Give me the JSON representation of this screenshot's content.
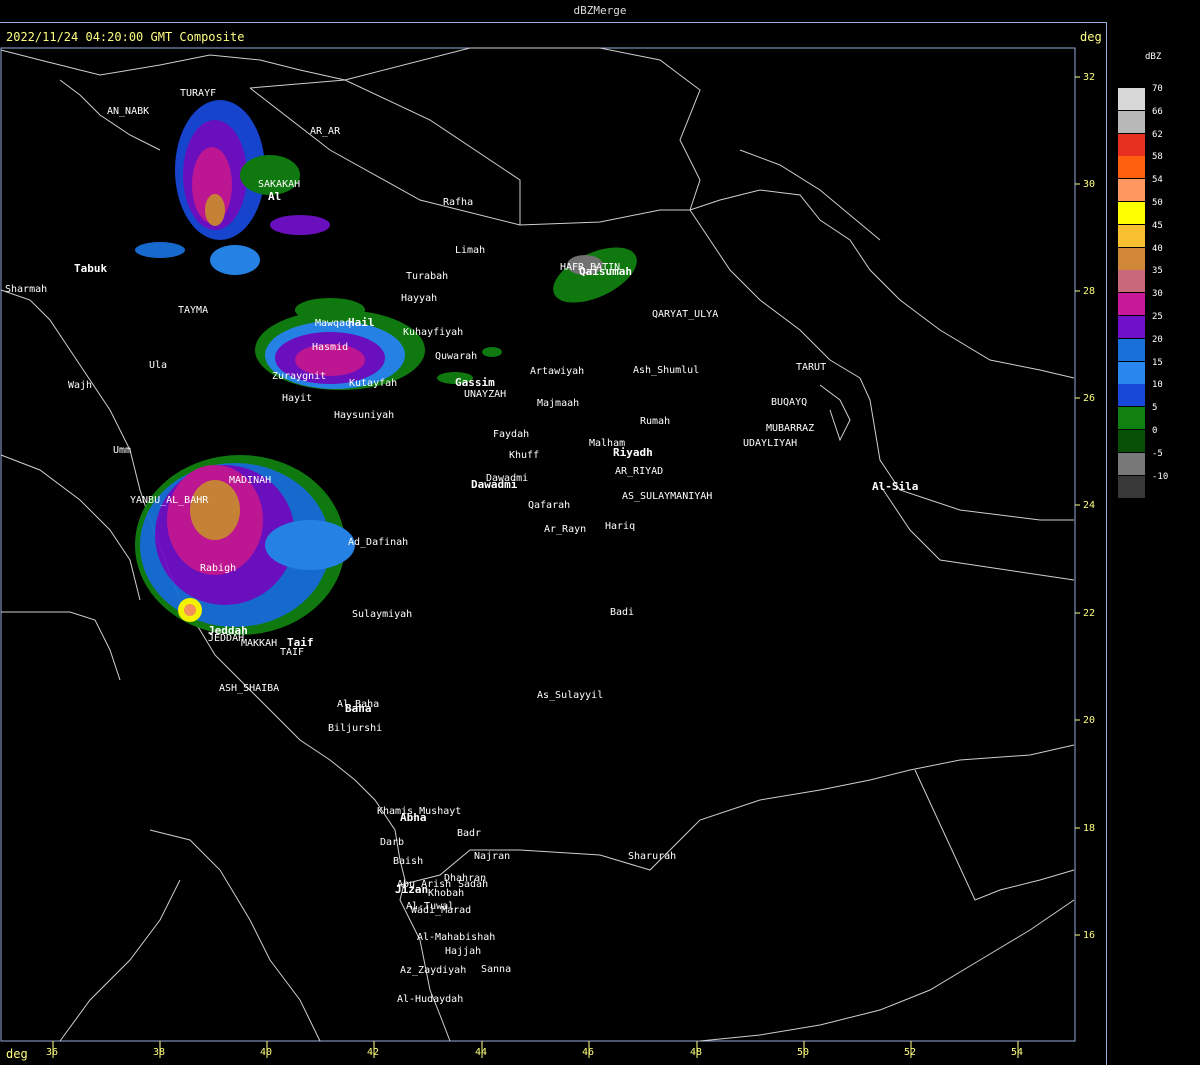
{
  "title": "dBZMerge",
  "header": "2022/11/24 04:20:00 GMT Composite",
  "deg_label_top": "deg",
  "deg_label_bottom": "deg",
  "legend": {
    "unit": "dBZ",
    "levels": [
      {
        "label": "70",
        "color": "#d8d8d8"
      },
      {
        "label": "66",
        "color": "#b8b8b8"
      },
      {
        "label": "62",
        "color": "#e83020"
      },
      {
        "label": "58",
        "color": "#ff6010"
      },
      {
        "label": "54",
        "color": "#ff9860"
      },
      {
        "label": "50",
        "color": "#ffff00"
      },
      {
        "label": "45",
        "color": "#f8c030"
      },
      {
        "label": "40",
        "color": "#d08838"
      },
      {
        "label": "35",
        "color": "#c86878"
      },
      {
        "label": "30",
        "color": "#c8189a"
      },
      {
        "label": "25",
        "color": "#7010c8"
      },
      {
        "label": "20",
        "color": "#1870d8"
      },
      {
        "label": "15",
        "color": "#2888f0"
      },
      {
        "label": "10",
        "color": "#1848d8"
      },
      {
        "label": "5",
        "color": "#108010"
      },
      {
        "label": "0",
        "color": "#085008"
      },
      {
        "label": "-5",
        "color": "#787878"
      },
      {
        "label": "-10",
        "color": "#383838"
      }
    ]
  },
  "lat_ticks": [
    "32",
    "30",
    "28",
    "26",
    "24",
    "22",
    "20",
    "18",
    "16"
  ],
  "lon_ticks": [
    "36",
    "38",
    "40",
    "42",
    "44",
    "46",
    "48",
    "50",
    "52",
    "54"
  ],
  "places": [
    {
      "name": "AN_NABK"
    },
    {
      "name": "TURAYF"
    },
    {
      "name": "AR_AR"
    },
    {
      "name": "SAKAKAH"
    },
    {
      "name": "Al"
    },
    {
      "name": "Rafha"
    },
    {
      "name": "Limah"
    },
    {
      "name": "Tabuk"
    },
    {
      "name": "Sharmah"
    },
    {
      "name": "TAYMA"
    },
    {
      "name": "Turabah"
    },
    {
      "name": "Hayyah"
    },
    {
      "name": "Mawqaq"
    },
    {
      "name": "Hail"
    },
    {
      "name": "Kuhayfiyah"
    },
    {
      "name": "Hasmid"
    },
    {
      "name": "Quwarah"
    },
    {
      "name": "Zuraygnit"
    },
    {
      "name": "Kutayfah"
    },
    {
      "name": "Gassim"
    },
    {
      "name": "UNAYZAH"
    },
    {
      "name": "Hayit"
    },
    {
      "name": "Haysuniyah"
    },
    {
      "name": "Ula"
    },
    {
      "name": "Wajh"
    },
    {
      "name": "Umm"
    },
    {
      "name": "MADINAH"
    },
    {
      "name": "YANBU_AL_BAHR"
    },
    {
      "name": "Ad_Dafinah"
    },
    {
      "name": "Rabigh"
    },
    {
      "name": "Jeddah"
    },
    {
      "name": "JEDDAH"
    },
    {
      "name": "MAKKAH"
    },
    {
      "name": "Taif"
    },
    {
      "name": "TAIF"
    },
    {
      "name": "Sulaymiyah"
    },
    {
      "name": "ASH_SHAIBA"
    },
    {
      "name": "Al_Baha"
    },
    {
      "name": "Baha"
    },
    {
      "name": "Biljurshi"
    },
    {
      "name": "HAFR_BATIN"
    },
    {
      "name": "Qaisumah"
    },
    {
      "name": "QARYAT_ULYA"
    },
    {
      "name": "Artawiyah"
    },
    {
      "name": "Ash_Shumlul"
    },
    {
      "name": "Majmaah"
    },
    {
      "name": "Rumah"
    },
    {
      "name": "Faydah"
    },
    {
      "name": "Khuff"
    },
    {
      "name": "Malham"
    },
    {
      "name": "Riyadh"
    },
    {
      "name": "AR_RIYAD"
    },
    {
      "name": "Dawadmi"
    },
    {
      "name": "Dawadmi"
    },
    {
      "name": "AS_SULAYMANIYAH"
    },
    {
      "name": "Qafarah"
    },
    {
      "name": "Ar_Rayn"
    },
    {
      "name": "Hariq"
    },
    {
      "name": "Badi"
    },
    {
      "name": "As_Sulayyil"
    },
    {
      "name": "TARUT"
    },
    {
      "name": "BUQAYQ"
    },
    {
      "name": "MUBARRAZ"
    },
    {
      "name": "UDAYLIYAH"
    },
    {
      "name": "Al-Sila"
    },
    {
      "name": "Khamis_Mushayt"
    },
    {
      "name": "Abha"
    },
    {
      "name": "Badr"
    },
    {
      "name": "Darb"
    },
    {
      "name": "Baish"
    },
    {
      "name": "Najran"
    },
    {
      "name": "Sharurah"
    },
    {
      "name": "Dhahran"
    },
    {
      "name": "Sadah"
    },
    {
      "name": "Abu_Arish"
    },
    {
      "name": "Jizan"
    },
    {
      "name": "Khobah"
    },
    {
      "name": "Al-Tuwal"
    },
    {
      "name": "Wadi_Marad"
    },
    {
      "name": "Al-Mahabishah"
    },
    {
      "name": "Hajjah"
    },
    {
      "name": "Az_Zaydiyah"
    },
    {
      "name": "Sanna"
    },
    {
      "name": "Al-Hudaydah"
    }
  ]
}
